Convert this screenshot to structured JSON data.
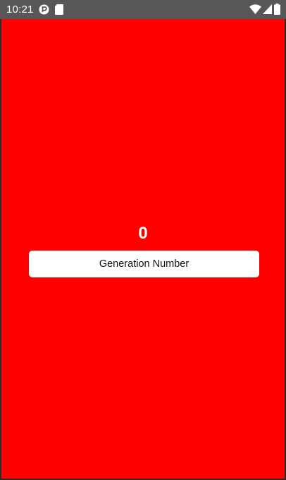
{
  "status_bar": {
    "time": "10:21",
    "icons": [
      "app-notification-icon",
      "sd-card-icon",
      "wifi-icon",
      "cellular-signal-icon",
      "battery-icon"
    ]
  },
  "app": {
    "background_color": "#ff0000",
    "counter_value": "0",
    "button_label": "Generation Number"
  }
}
